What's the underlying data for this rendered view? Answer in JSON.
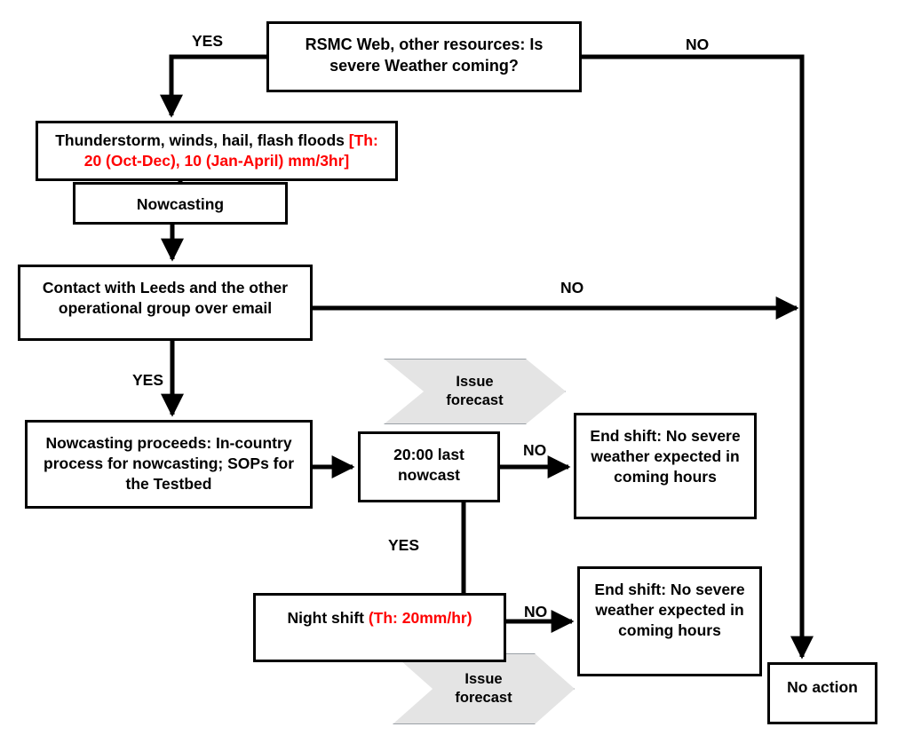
{
  "diagram": {
    "title": "Severe weather nowcasting decision flowchart",
    "colors": {
      "line": "#000000",
      "node_border": "#000000",
      "chevron_fill": "#e4e4e4",
      "chevron_border": "#9aa0a6",
      "threshold_text": "#ff0000"
    }
  },
  "nodes": {
    "rsmc": {
      "line1": "RSMC Web, other resources: Is",
      "line2": "severe Weather coming?"
    },
    "thunderstorm": {
      "black_part": "Thunderstorm, winds, hail, flash floods ",
      "red_part_line1": "[Th:",
      "red_part_line2": "20 (Oct-Dec), 10 (Jan-April) mm/3hr]"
    },
    "nowcasting": {
      "label": "Nowcasting"
    },
    "contact": {
      "line1": "Contact with Leeds and the other",
      "line2": "operational group over email"
    },
    "proceeds": {
      "line1": "Nowcasting proceeds: In-country",
      "line2": "process for nowcasting; SOPs for",
      "line3": "the Testbed"
    },
    "nowcast_2000": {
      "line1": "20:00 last",
      "line2": "nowcast"
    },
    "end_shift_1": {
      "line1": "End shift: No severe",
      "line2": "weather expected in",
      "line3": "coming hours"
    },
    "night_shift": {
      "black_part": "Night shift ",
      "red_part": "(Th: 20mm/hr)"
    },
    "end_shift_2": {
      "line1": "End shift: No severe",
      "line2": "weather expected in",
      "line3": "coming hours"
    },
    "no_action": {
      "label": "No action"
    },
    "issue_forecast_top": {
      "line1": "Issue",
      "line2": "forecast"
    },
    "issue_forecast_bottom": {
      "line1": "Issue",
      "line2": "forecast"
    }
  },
  "edge_labels": {
    "yes_top": "YES",
    "no_top": "NO",
    "no_contact": "NO",
    "yes_contact": "YES",
    "no_nowcast": "NO",
    "yes_night": "YES",
    "no_night": "NO"
  }
}
